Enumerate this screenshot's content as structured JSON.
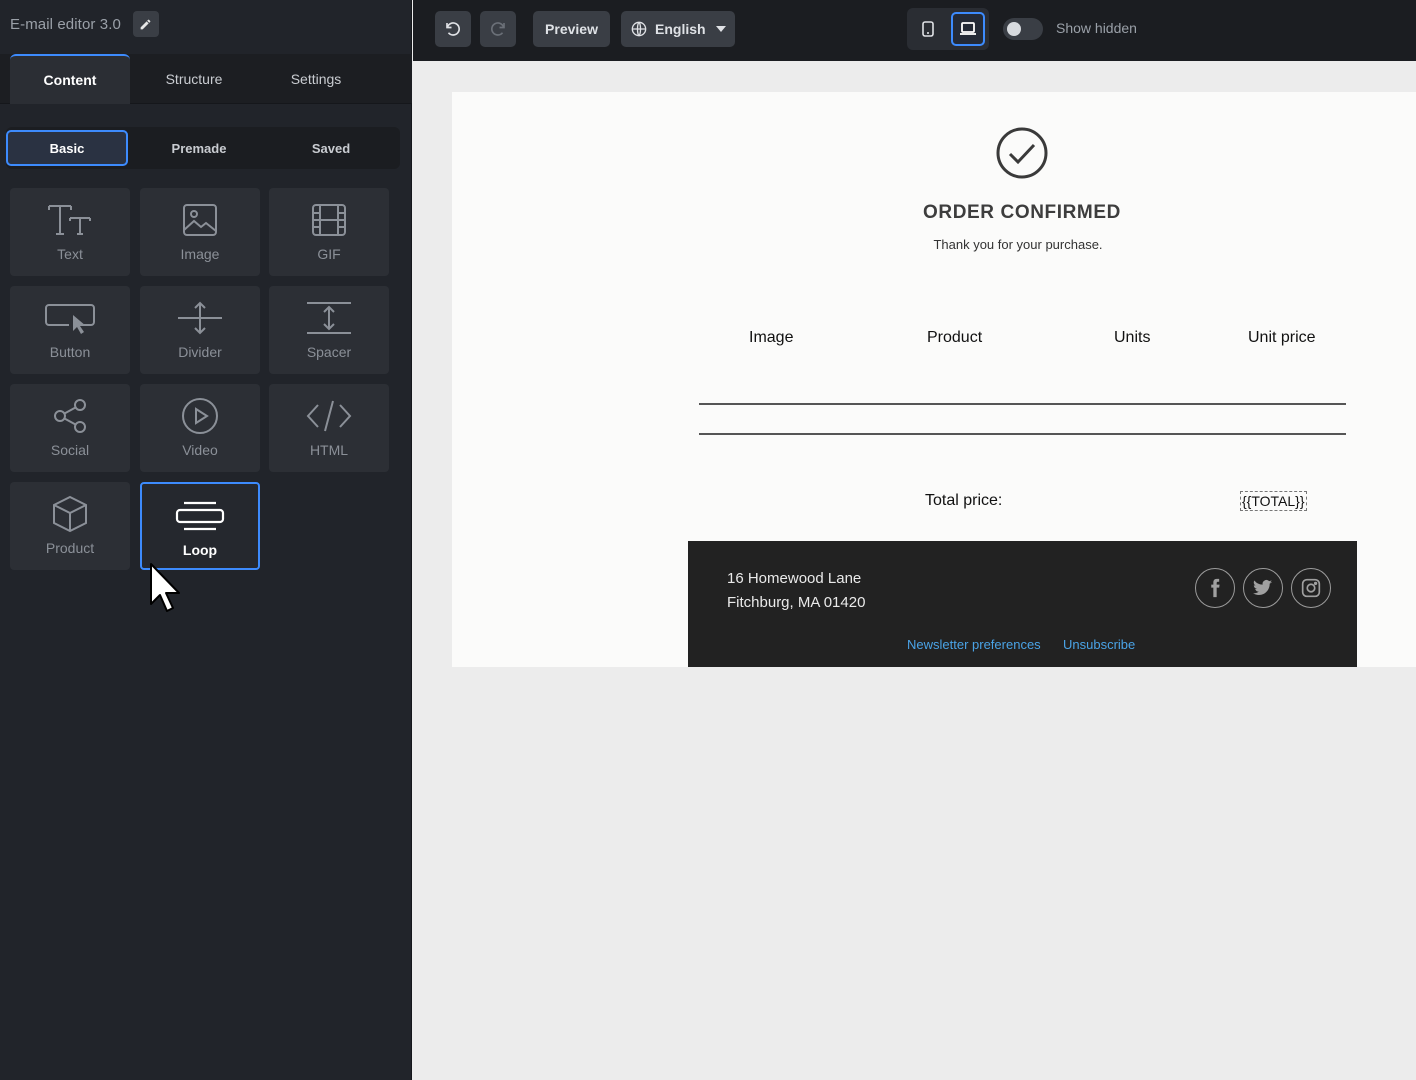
{
  "app": {
    "title": "E-mail editor 3.0"
  },
  "tabs": {
    "main": [
      "Content",
      "Structure",
      "Settings"
    ],
    "sub": [
      "Basic",
      "Premade",
      "Saved"
    ]
  },
  "blocks": [
    {
      "label": "Text",
      "icon": "text-icon"
    },
    {
      "label": "Image",
      "icon": "image-icon"
    },
    {
      "label": "GIF",
      "icon": "gif-icon"
    },
    {
      "label": "Button",
      "icon": "button-icon"
    },
    {
      "label": "Divider",
      "icon": "divider-icon"
    },
    {
      "label": "Spacer",
      "icon": "spacer-icon"
    },
    {
      "label": "Social",
      "icon": "share-icon"
    },
    {
      "label": "Video",
      "icon": "play-icon"
    },
    {
      "label": "HTML",
      "icon": "code-icon"
    },
    {
      "label": "Product",
      "icon": "box-icon"
    },
    {
      "label": "Loop",
      "icon": "loop-icon"
    }
  ],
  "toolbar": {
    "preview": "Preview",
    "language": "English",
    "show_hidden": "Show hidden",
    "show_hidden_on": false
  },
  "email": {
    "title": "ORDER CONFIRMED",
    "subtitle": "Thank you for your purchase.",
    "columns": [
      "Image",
      "Product",
      "Units",
      "Unit price"
    ],
    "total_label": "Total price:",
    "total_value": "{{TOTAL}}",
    "footer": {
      "address_line1": "16 Homewood Lane",
      "address_line2": "Fitchburg, MA 01420",
      "link1": "Newsletter preferences",
      "link2": "Unsubscribe",
      "social": [
        "facebook-icon",
        "twitter-icon",
        "instagram-icon"
      ]
    }
  },
  "colors": {
    "accent": "#3d8bfd",
    "sidebar_bg": "#21242a",
    "footer_bg": "#222222",
    "link": "#4aa3e6"
  }
}
